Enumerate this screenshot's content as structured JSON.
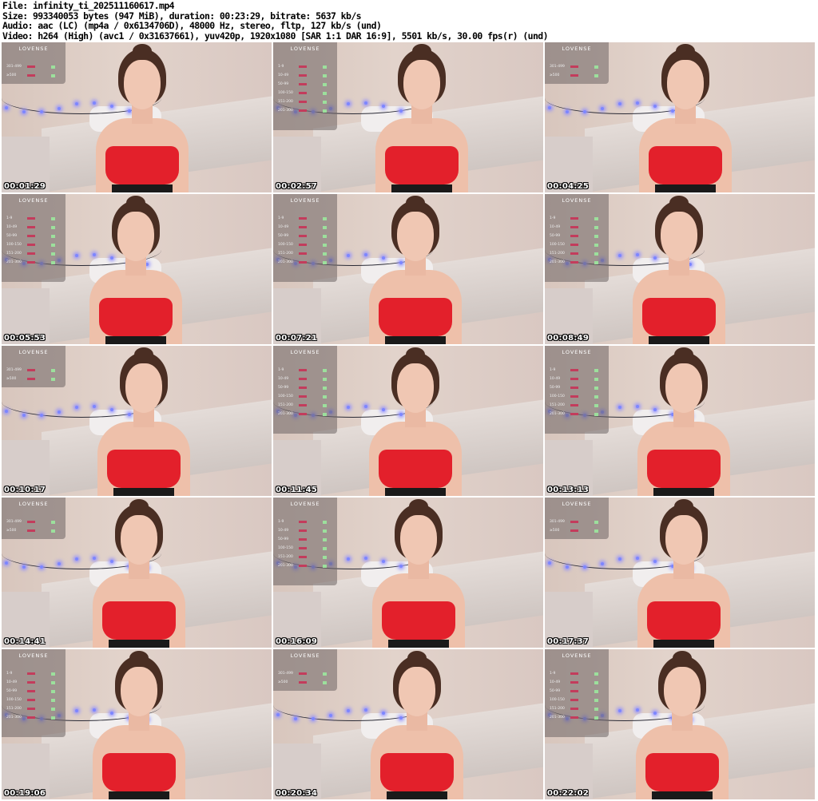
{
  "header": {
    "file": "File: infinity_ti_202511160617.mp4",
    "size": "Size: 993340053 bytes (947 MiB), duration: 00:23:29, bitrate: 5637 kb/s",
    "audio": "Audio: aac (LC) (mp4a / 0x6134706D), 48000 Hz, stereo, fltp, 127 kb/s (und)",
    "video": "Video: h264 (High) (avc1 / 0x31637661), yuv420p, 1920x1080 [SAR 1:1 DAR 16:9], 5501 kb/s, 30.00 fps(r) (und)"
  },
  "overlay_logo": "LOVENSE",
  "thumbnails": [
    {
      "timestamp": "00:01:29",
      "overlay": "short",
      "offset": 108
    },
    {
      "timestamp": "00:02:57",
      "overlay": "tall",
      "offset": 118
    },
    {
      "timestamp": "00:04:25",
      "overlay": "short",
      "offset": 108
    },
    {
      "timestamp": "00:05:53",
      "overlay": "tall",
      "offset": 100
    },
    {
      "timestamp": "00:07:21",
      "overlay": "tall",
      "offset": 110
    },
    {
      "timestamp": "00:08:49",
      "overlay": "tall",
      "offset": 100
    },
    {
      "timestamp": "00:10:17",
      "overlay": "short",
      "offset": 110
    },
    {
      "timestamp": "00:11:45",
      "overlay": "tall",
      "offset": 110
    },
    {
      "timestamp": "00:13:13",
      "overlay": "tall",
      "offset": 106
    },
    {
      "timestamp": "00:14:41",
      "overlay": "short",
      "offset": 104
    },
    {
      "timestamp": "00:16:09",
      "overlay": "tall",
      "offset": 114
    },
    {
      "timestamp": "00:17:37",
      "overlay": "short",
      "offset": 106
    },
    {
      "timestamp": "00:19:06",
      "overlay": "tall",
      "offset": 104
    },
    {
      "timestamp": "00:20:34",
      "overlay": "short",
      "offset": 112
    },
    {
      "timestamp": "00:22:02",
      "overlay": "tall",
      "offset": 104
    }
  ]
}
